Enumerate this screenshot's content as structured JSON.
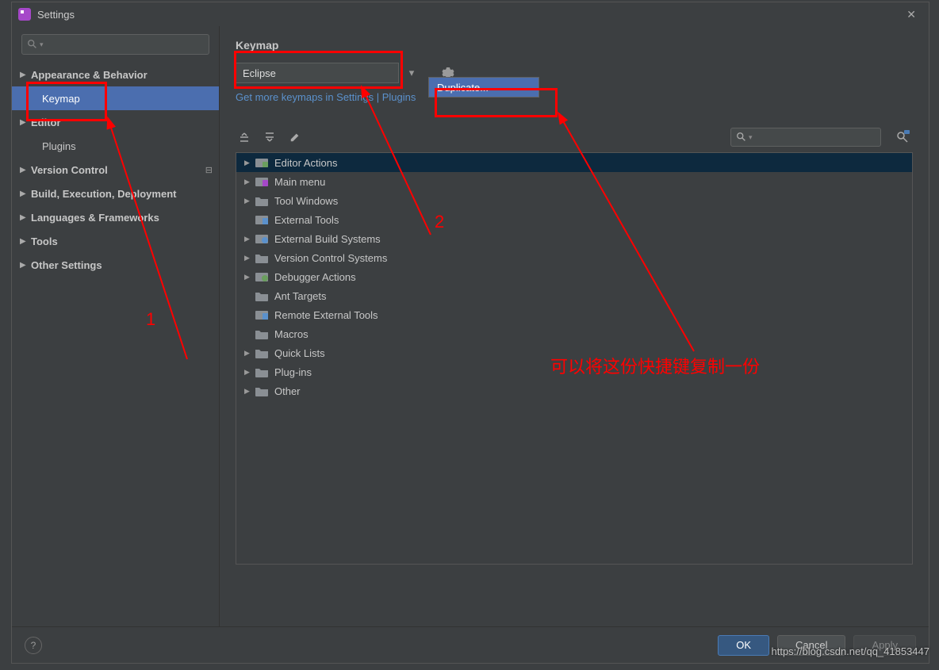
{
  "window": {
    "title": "Settings"
  },
  "sidebar": {
    "items": [
      {
        "label": "Appearance & Behavior",
        "expandable": true,
        "child": false
      },
      {
        "label": "Keymap",
        "expandable": false,
        "child": true,
        "selected": true
      },
      {
        "label": "Editor",
        "expandable": true,
        "child": false
      },
      {
        "label": "Plugins",
        "expandable": false,
        "child": true
      },
      {
        "label": "Version Control",
        "expandable": true,
        "child": false,
        "tagged": true
      },
      {
        "label": "Build, Execution, Deployment",
        "expandable": true,
        "child": false
      },
      {
        "label": "Languages & Frameworks",
        "expandable": true,
        "child": false
      },
      {
        "label": "Tools",
        "expandable": true,
        "child": false
      },
      {
        "label": "Other Settings",
        "expandable": true,
        "child": false
      }
    ]
  },
  "main": {
    "title": "Keymap",
    "selected_keymap": "Eclipse",
    "link_text": "Get more keymaps in Settings | Plugins",
    "popup": {
      "item": "Duplicate..."
    },
    "actions": [
      {
        "label": "Editor Actions",
        "expandable": true,
        "highlight": true,
        "icon": "special"
      },
      {
        "label": "Main menu",
        "expandable": true,
        "icon": "app"
      },
      {
        "label": "Tool Windows",
        "expandable": true,
        "icon": "folder"
      },
      {
        "label": "External Tools",
        "expandable": false,
        "icon": "tools"
      },
      {
        "label": "External Build Systems",
        "expandable": true,
        "icon": "gear"
      },
      {
        "label": "Version Control Systems",
        "expandable": true,
        "icon": "folder"
      },
      {
        "label": "Debugger Actions",
        "expandable": true,
        "icon": "bug"
      },
      {
        "label": "Ant Targets",
        "expandable": false,
        "icon": "folder"
      },
      {
        "label": "Remote External Tools",
        "expandable": false,
        "icon": "tools"
      },
      {
        "label": "Macros",
        "expandable": false,
        "icon": "folder"
      },
      {
        "label": "Quick Lists",
        "expandable": true,
        "icon": "folder"
      },
      {
        "label": "Plug-ins",
        "expandable": true,
        "icon": "folder"
      },
      {
        "label": "Other",
        "expandable": true,
        "icon": "folder"
      }
    ]
  },
  "footer": {
    "ok": "OK",
    "cancel": "Cancel",
    "apply": "Apply"
  },
  "annotations": {
    "label1": "1",
    "label2": "2",
    "note": "可以将这份快捷键复制一份"
  },
  "watermark": "https://blog.csdn.net/qq_41853447"
}
